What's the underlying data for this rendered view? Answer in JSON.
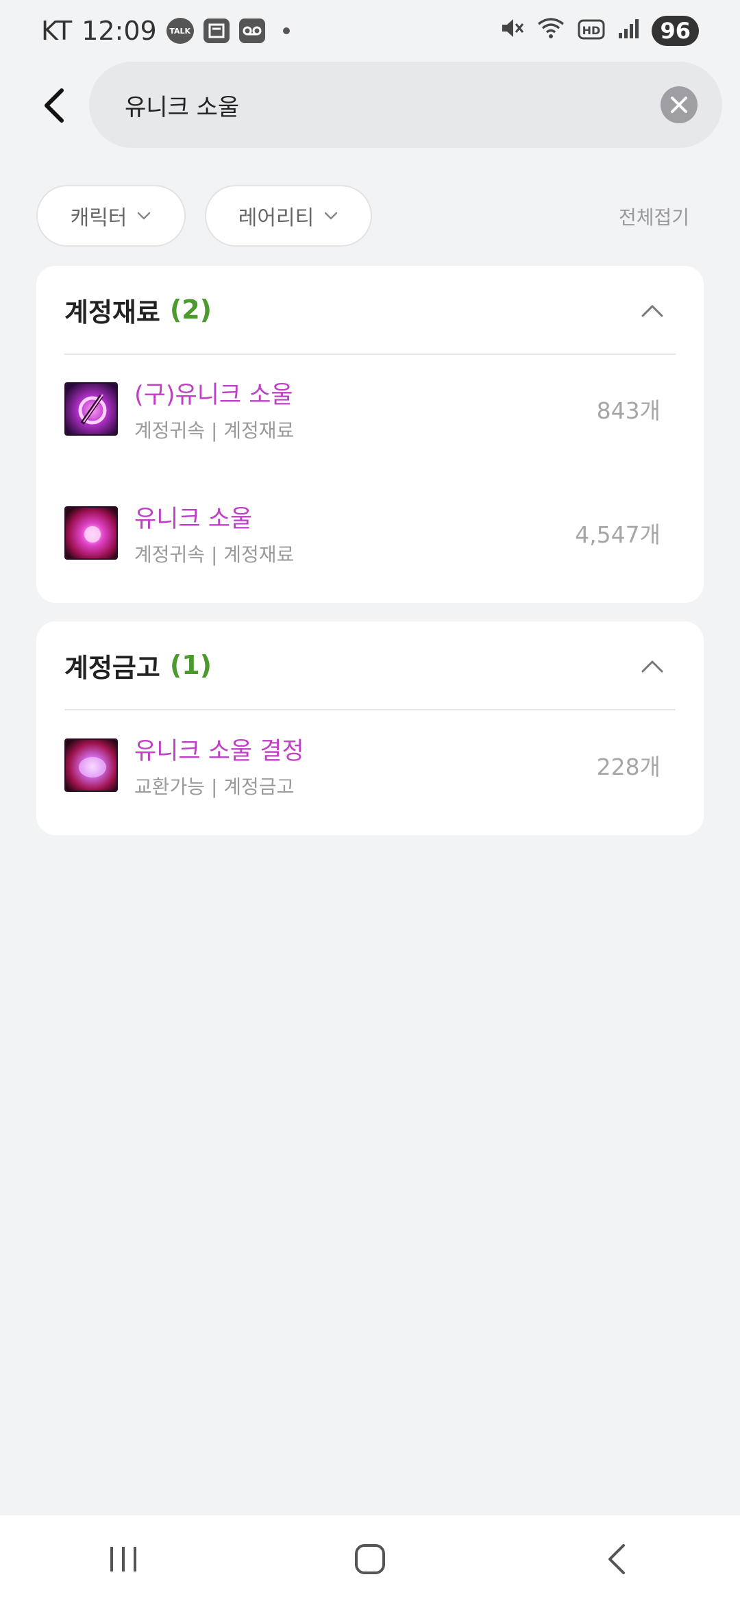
{
  "status_bar": {
    "carrier": "KT",
    "time": "12:09",
    "notif_icons": [
      "kakaotalk-icon",
      "news-icon",
      "voicemail-icon"
    ],
    "battery": "96"
  },
  "search": {
    "value": "유니크 소울",
    "placeholder": ""
  },
  "filters": {
    "character_label": "캐릭터",
    "rarity_label": "레어리티",
    "collapse_all": "전체접기"
  },
  "sections": [
    {
      "title": "계정재료",
      "count": "(2)",
      "items": [
        {
          "name": "(구)유니크 소울",
          "sub": "계정귀속 | 계정재료",
          "qty": "843개",
          "icon": "old-unique-soul-icon"
        },
        {
          "name": "유니크 소울",
          "sub": "계정귀속 | 계정재료",
          "qty": "4,547개",
          "icon": "unique-soul-icon"
        }
      ]
    },
    {
      "title": "계정금고",
      "count": "(1)",
      "items": [
        {
          "name": "유니크 소울 결정",
          "sub": "교환가능 | 계정금고",
          "qty": "228개",
          "icon": "unique-soul-crystal-icon"
        }
      ]
    }
  ],
  "colors": {
    "accent_green": "#4a9a2e",
    "item_name_purple": "#c03fc6",
    "background": "#f2f3f5"
  }
}
